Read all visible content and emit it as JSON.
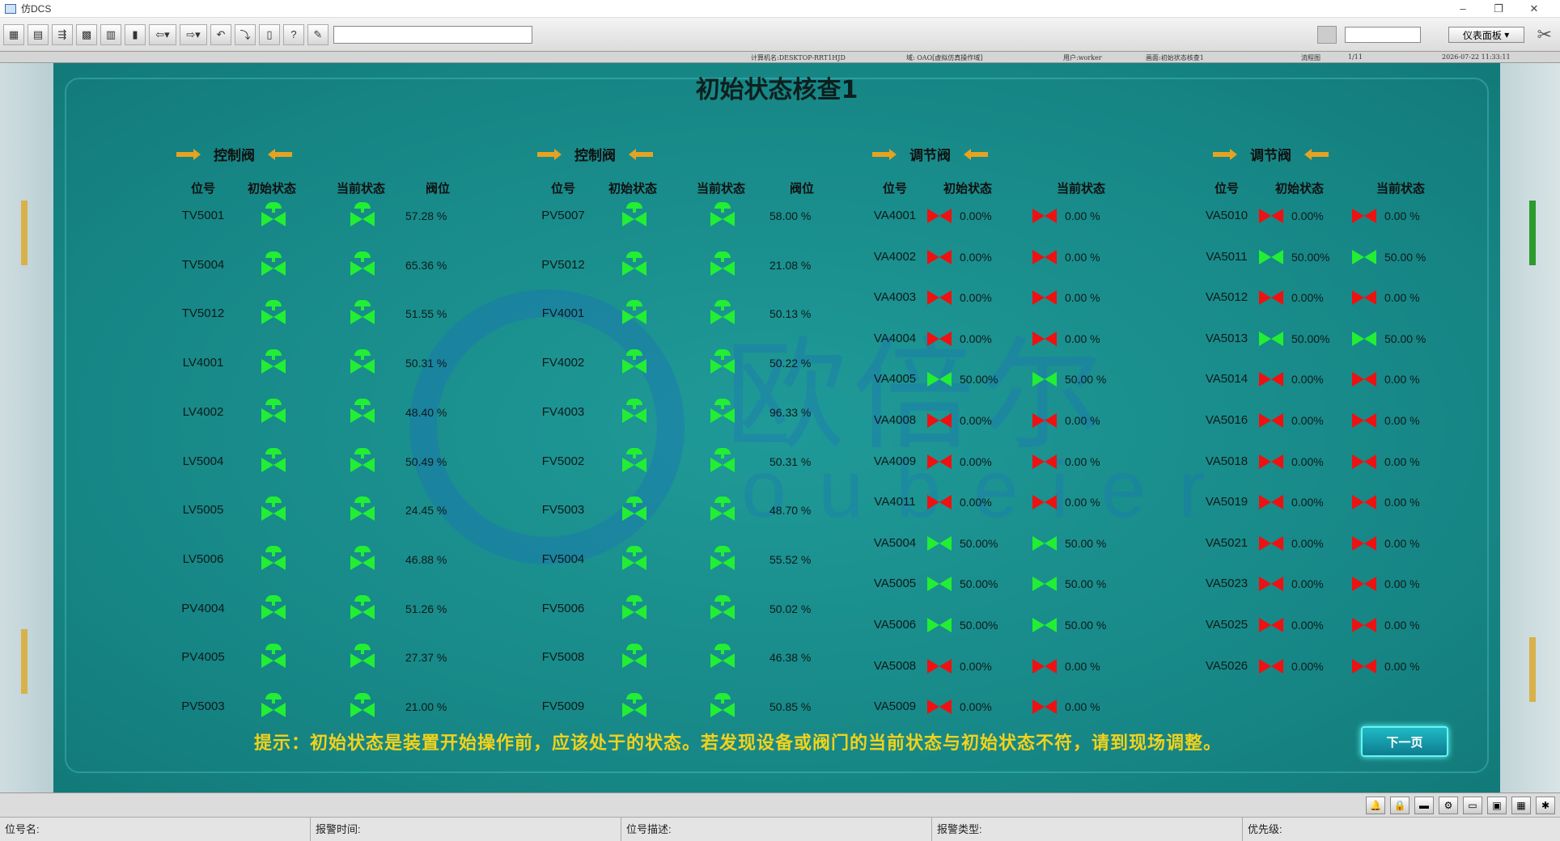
{
  "window": {
    "title": "仿DCS",
    "minimize": "–",
    "restore": "❐",
    "close": "✕"
  },
  "toolbar": {
    "buttons": [
      "▦",
      "▤",
      "⇶",
      "▩",
      "▥",
      "▮",
      "⇦▾",
      "⇨▾",
      "↶",
      "⤵",
      "▯",
      "?",
      "✎"
    ],
    "panel_select": "仪表面板",
    "tools_icon": "✂"
  },
  "info": {
    "computer": "计算机名:DESKTOP-RRT1HJD",
    "domain": "域: OAO[虚拟仿真操作域]",
    "user": "用户:worker",
    "screen": "画面:初始状态核查1",
    "flow": "流程图",
    "page": "1/11",
    "datetime": "2026-07-22 11:33:11"
  },
  "page": {
    "title": "初始状态核查1"
  },
  "watermark": {
    "text": "欧倍尔",
    "sub": "oubeier"
  },
  "groups": [
    {
      "title": "控制阀",
      "headers": [
        "位号",
        "初始状态",
        "当前状态",
        "阀位"
      ],
      "rows": [
        {
          "tag": "TV5001",
          "value": "57.28 %"
        },
        {
          "tag": "TV5004",
          "value": "65.36 %"
        },
        {
          "tag": "TV5012",
          "value": "51.55 %"
        },
        {
          "tag": "LV4001",
          "value": "50.31 %"
        },
        {
          "tag": "LV4002",
          "value": "48.40 %"
        },
        {
          "tag": "LV5004",
          "value": "50.49 %"
        },
        {
          "tag": "LV5005",
          "value": "24.45 %"
        },
        {
          "tag": "LV5006",
          "value": "46.88 %"
        },
        {
          "tag": "PV4004",
          "value": "51.26 %"
        },
        {
          "tag": "PV4005",
          "value": "27.37 %"
        },
        {
          "tag": "PV5003",
          "value": "21.00 %"
        }
      ]
    },
    {
      "title": "控制阀",
      "headers": [
        "位号",
        "初始状态",
        "当前状态",
        "阀位"
      ],
      "rows": [
        {
          "tag": "PV5007",
          "value": "58.00 %"
        },
        {
          "tag": "PV5012",
          "value": "21.08 %"
        },
        {
          "tag": "FV4001",
          "value": "50.13 %"
        },
        {
          "tag": "FV4002",
          "value": "50.22 %"
        },
        {
          "tag": "FV4003",
          "value": "96.33 %"
        },
        {
          "tag": "FV5002",
          "value": "50.31 %"
        },
        {
          "tag": "FV5003",
          "value": "48.70 %"
        },
        {
          "tag": "FV5004",
          "value": "55.52 %"
        },
        {
          "tag": "FV5006",
          "value": "50.02 %"
        },
        {
          "tag": "FV5008",
          "value": "46.38 %"
        },
        {
          "tag": "FV5009",
          "value": "50.85 %"
        }
      ]
    },
    {
      "title": "调节阀",
      "headers": [
        "位号",
        "初始状态",
        "当前状态"
      ],
      "rows": [
        {
          "tag": "VA4001",
          "init": "0.00%",
          "cur": "0.00 %",
          "init_state": "red",
          "cur_state": "red"
        },
        {
          "tag": "VA4002",
          "init": "0.00%",
          "cur": "0.00 %",
          "init_state": "red",
          "cur_state": "red"
        },
        {
          "tag": "VA4003",
          "init": "0.00%",
          "cur": "0.00 %",
          "init_state": "red",
          "cur_state": "red"
        },
        {
          "tag": "VA4004",
          "init": "0.00%",
          "cur": "0.00 %",
          "init_state": "red",
          "cur_state": "red"
        },
        {
          "tag": "VA4005",
          "init": "50.00%",
          "cur": "50.00 %",
          "init_state": "green",
          "cur_state": "green"
        },
        {
          "tag": "VA4008",
          "init": "0.00%",
          "cur": "0.00 %",
          "init_state": "red",
          "cur_state": "red"
        },
        {
          "tag": "VA4009",
          "init": "0.00%",
          "cur": "0.00 %",
          "init_state": "red",
          "cur_state": "red"
        },
        {
          "tag": "VA4011",
          "init": "0.00%",
          "cur": "0.00 %",
          "init_state": "red",
          "cur_state": "red"
        },
        {
          "tag": "VA5004",
          "init": "50.00%",
          "cur": "50.00 %",
          "init_state": "green",
          "cur_state": "green"
        },
        {
          "tag": "VA5005",
          "init": "50.00%",
          "cur": "50.00 %",
          "init_state": "green",
          "cur_state": "green"
        },
        {
          "tag": "VA5006",
          "init": "50.00%",
          "cur": "50.00 %",
          "init_state": "green",
          "cur_state": "green"
        },
        {
          "tag": "VA5008",
          "init": "0.00%",
          "cur": "0.00 %",
          "init_state": "red",
          "cur_state": "red"
        },
        {
          "tag": "VA5009",
          "init": "0.00%",
          "cur": "0.00 %",
          "init_state": "red",
          "cur_state": "red"
        }
      ]
    },
    {
      "title": "调节阀",
      "headers": [
        "位号",
        "初始状态",
        "当前状态"
      ],
      "rows": [
        {
          "tag": "VA5010",
          "init": "0.00%",
          "cur": "0.00 %",
          "init_state": "red",
          "cur_state": "red"
        },
        {
          "tag": "VA5011",
          "init": "50.00%",
          "cur": "50.00 %",
          "init_state": "green",
          "cur_state": "green"
        },
        {
          "tag": "VA5012",
          "init": "0.00%",
          "cur": "0.00 %",
          "init_state": "red",
          "cur_state": "red"
        },
        {
          "tag": "VA5013",
          "init": "50.00%",
          "cur": "50.00 %",
          "init_state": "green",
          "cur_state": "green"
        },
        {
          "tag": "VA5014",
          "init": "0.00%",
          "cur": "0.00 %",
          "init_state": "red",
          "cur_state": "red"
        },
        {
          "tag": "VA5016",
          "init": "0.00%",
          "cur": "0.00 %",
          "init_state": "red",
          "cur_state": "red"
        },
        {
          "tag": "VA5018",
          "init": "0.00%",
          "cur": "0.00 %",
          "init_state": "red",
          "cur_state": "red"
        },
        {
          "tag": "VA5019",
          "init": "0.00%",
          "cur": "0.00 %",
          "init_state": "red",
          "cur_state": "red"
        },
        {
          "tag": "VA5021",
          "init": "0.00%",
          "cur": "0.00 %",
          "init_state": "red",
          "cur_state": "red"
        },
        {
          "tag": "VA5023",
          "init": "0.00%",
          "cur": "0.00 %",
          "init_state": "red",
          "cur_state": "red"
        },
        {
          "tag": "VA5025",
          "init": "0.00%",
          "cur": "0.00 %",
          "init_state": "red",
          "cur_state": "red"
        },
        {
          "tag": "VA5026",
          "init": "0.00%",
          "cur": "0.00 %",
          "init_state": "red",
          "cur_state": "red"
        }
      ]
    }
  ],
  "hint": "提示：初始状态是装置开始操作前，应该处于的状态。若发现设备或阀门的当前状态与初始状态不符，请到现场调整。",
  "next_button": "下一页",
  "bottom_icons": [
    "🔔",
    "🔒",
    "▬",
    "⚙",
    "▭",
    "▣",
    "▦",
    "✱"
  ],
  "status": {
    "tag_name": "位号名:",
    "alarm_time": "报警时间:",
    "tag_desc": "位号描述:",
    "alarm_type": "报警类型:",
    "priority": "优先级:"
  },
  "colors": {
    "panel": "#1c8c8c",
    "valve_on": "#22ee33",
    "valve_off": "#ee1111",
    "hint": "#f2d21a",
    "arrow": "#e6a321"
  }
}
